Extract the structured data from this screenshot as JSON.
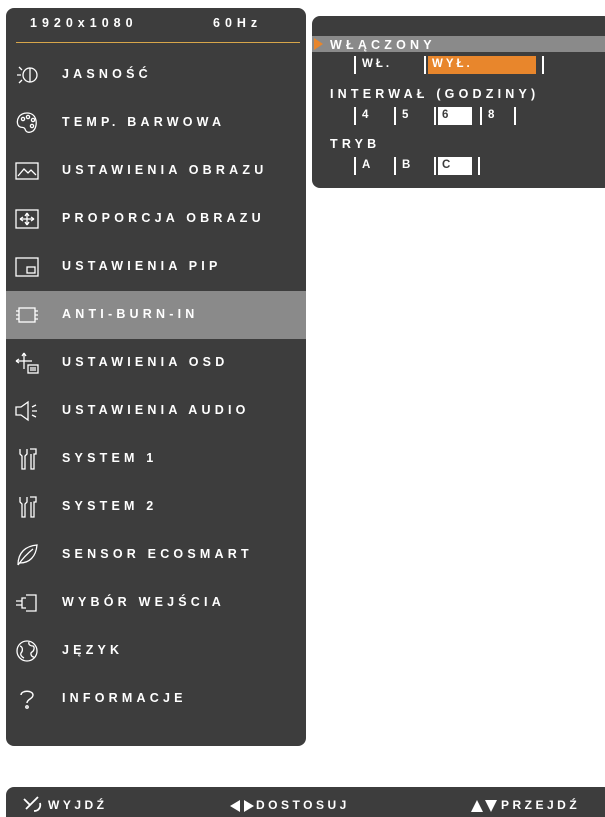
{
  "header": {
    "resolution": "1920x1080",
    "refresh": "60Hz"
  },
  "menu": {
    "items": [
      {
        "label": "JASNOŚĆ",
        "icon": "brightness-icon"
      },
      {
        "label": "TEMP. BARWOWA",
        "icon": "palette-icon"
      },
      {
        "label": "USTAWIENIA OBRAZU",
        "icon": "image-icon"
      },
      {
        "label": "PROPORCJA OBRAZU",
        "icon": "aspect-ratio-icon"
      },
      {
        "label": "USTAWIENIA PIP",
        "icon": "pip-icon"
      },
      {
        "label": "ANTI-BURN-IN",
        "icon": "chip-icon"
      },
      {
        "label": "USTAWIENIA OSD",
        "icon": "osd-icon"
      },
      {
        "label": "USTAWIENIA AUDIO",
        "icon": "speaker-icon"
      },
      {
        "label": "SYSTEM 1",
        "icon": "tools-icon"
      },
      {
        "label": "SYSTEM 2",
        "icon": "tools-icon"
      },
      {
        "label": "SENSOR ECOSMART",
        "icon": "leaf-icon"
      },
      {
        "label": "WYBÓR WEJŚCIA",
        "icon": "input-plug-icon"
      },
      {
        "label": "JĘZYK",
        "icon": "globe-icon"
      },
      {
        "label": "INFORMACJE",
        "icon": "question-icon"
      }
    ],
    "selected_index": 5
  },
  "submenu": {
    "enabled": {
      "title": "WŁĄCZONY",
      "options": [
        "WŁ.",
        "WYŁ."
      ],
      "selected": "WYŁ."
    },
    "interval": {
      "title": "INTERWAŁ (GODZINY)",
      "options": [
        "4",
        "5",
        "6",
        "8"
      ],
      "selected": "6"
    },
    "mode": {
      "title": "TRYB",
      "options": [
        "A",
        "B",
        "C"
      ],
      "selected": "C"
    }
  },
  "footer": {
    "exit_label": "WYJDŹ",
    "adjust_label": "DOSTOSUJ",
    "move_label": "PRZEJDŹ"
  },
  "colors": {
    "panel": "#3d3d3d",
    "highlight": "#8a8a8a",
    "accent": "#e8862c",
    "header_line": "#d8a64a"
  }
}
